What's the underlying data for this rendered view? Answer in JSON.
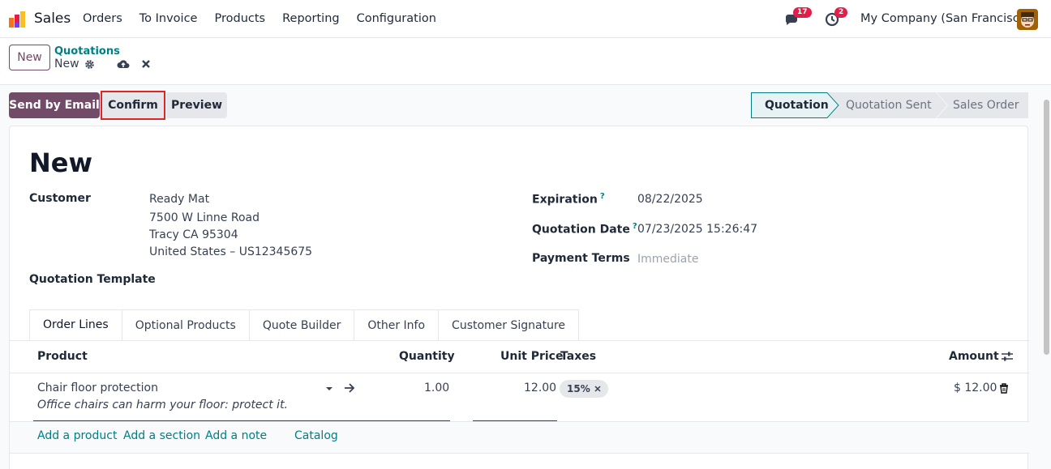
{
  "topbar": {
    "app_name": "Sales",
    "menu": [
      "Orders",
      "To Invoice",
      "Products",
      "Reporting",
      "Configuration"
    ],
    "messages_count": "17",
    "activities_count": "2",
    "company": "My Company (San Francisco)"
  },
  "control": {
    "new_label": "New",
    "breadcrumb_parent": "Quotations",
    "breadcrumb_current": "New"
  },
  "actions": {
    "send_email": "Send by Email",
    "confirm": "Confirm",
    "preview": "Preview"
  },
  "status": {
    "stages": [
      "Quotation",
      "Quotation Sent",
      "Sales Order"
    ],
    "active": "Quotation"
  },
  "form": {
    "title": "New",
    "customer_label": "Customer",
    "customer_name": "Ready Mat",
    "customer_address1": "7500 W Linne Road",
    "customer_address2": "Tracy CA 95304",
    "customer_address3": "United States – US12345675",
    "template_label": "Quotation Template",
    "expiration_label": "Expiration",
    "expiration_value": "08/22/2025",
    "quotation_date_label": "Quotation Date",
    "quotation_date_value": "07/23/2025 15:26:47",
    "payment_terms_label": "Payment Terms",
    "payment_terms_value": "Immediate",
    "help_mark": "?"
  },
  "tabs": [
    "Order Lines",
    "Optional Products",
    "Quote Builder",
    "Other Info",
    "Customer Signature"
  ],
  "table": {
    "headers": {
      "product": "Product",
      "quantity": "Quantity",
      "unit_price": "Unit Price",
      "taxes": "Taxes",
      "amount": "Amount"
    },
    "rows": [
      {
        "product": "Chair floor protection",
        "description": "Office chairs can harm your floor: protect it.",
        "quantity": "1.00",
        "unit_price": "12.00",
        "tax": "15%",
        "amount": "$ 12.00"
      }
    ],
    "links": [
      "Add a product",
      "Add a section",
      "Add a note",
      "Catalog"
    ]
  },
  "colors": {
    "brand": "#714b67",
    "accent": "#017e84",
    "highlight": "#dc2626"
  }
}
